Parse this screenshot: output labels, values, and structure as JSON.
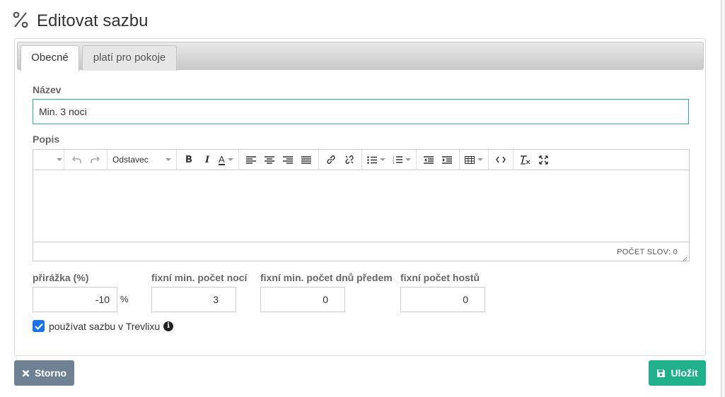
{
  "page": {
    "title": "Editovat sazbu",
    "title_icon": "percent-icon"
  },
  "tabs": [
    {
      "label": "Obecné",
      "active": true
    },
    {
      "label": "platí pro pokoje",
      "active": false
    }
  ],
  "form": {
    "name": {
      "label": "Název",
      "value": "Min. 3 noci"
    },
    "description": {
      "label": "Popis"
    },
    "editor": {
      "format_select": "Odstavec",
      "word_count": "POČET SLOV: 0"
    },
    "surcharge": {
      "label": "přirážka (%)",
      "value": "-10",
      "unit": "%"
    },
    "min_nights": {
      "label": "fixní min. počet nocí",
      "value": "3"
    },
    "min_days_ahead": {
      "label": "fixní min. počet dnů předem",
      "value": "0"
    },
    "fixed_guests": {
      "label": "fixní počet hostů",
      "value": "0"
    },
    "use_in_trevlix": {
      "label": "používat sazbu v Trevlixu",
      "checked": true
    }
  },
  "buttons": {
    "cancel": "Storno",
    "save": "Uložit"
  },
  "colors": {
    "accent": "#21b08c",
    "cancel": "#6f8293",
    "checkbox": "#1a73e8",
    "focus_border": "#2fae8f"
  }
}
